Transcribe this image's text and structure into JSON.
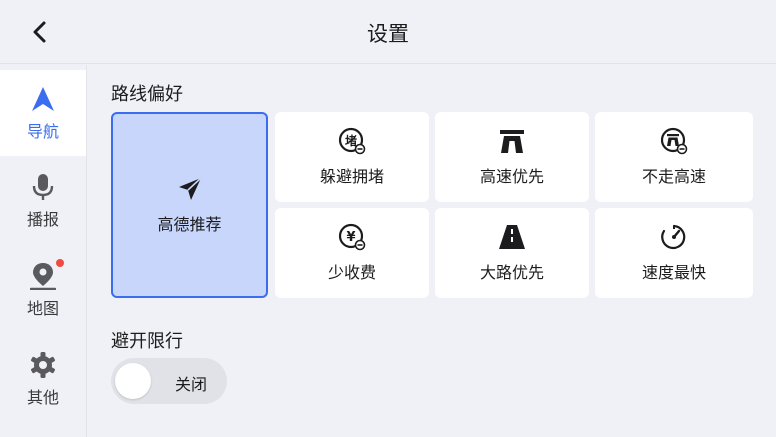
{
  "header": {
    "title": "设置",
    "back_icon": "chevron-left-icon"
  },
  "sidebar": {
    "items": [
      {
        "label": "导航",
        "icon": "navigation-arrow-icon",
        "active": true
      },
      {
        "label": "播报",
        "icon": "microphone-icon",
        "active": false
      },
      {
        "label": "地图",
        "icon": "map-pin-icon",
        "active": false,
        "badge": "red-dot"
      },
      {
        "label": "其他",
        "icon": "gear-icon",
        "active": false
      }
    ]
  },
  "route_pref": {
    "title": "路线偏好",
    "options": [
      {
        "label": "高德推荐",
        "icon": "paper-plane-icon",
        "selected": true
      },
      {
        "label": "躲避拥堵",
        "icon": "avoid-congestion-icon",
        "selected": false
      },
      {
        "label": "高速优先",
        "icon": "highway-icon",
        "selected": false
      },
      {
        "label": "不走高速",
        "icon": "no-highway-icon",
        "selected": false
      },
      {
        "label": "少收费",
        "icon": "yuan-toll-icon",
        "selected": false
      },
      {
        "label": "大路优先",
        "icon": "main-road-icon",
        "selected": false
      },
      {
        "label": "速度最快",
        "icon": "speedometer-icon",
        "selected": false
      }
    ]
  },
  "avoid_restriction": {
    "title": "避开限行",
    "toggle_label": "关闭",
    "enabled": false
  },
  "colors": {
    "accent": "#3a6df0",
    "selected_bg": "#c7d6fa",
    "background": "#f0f1f6",
    "badge": "#f24a43"
  }
}
